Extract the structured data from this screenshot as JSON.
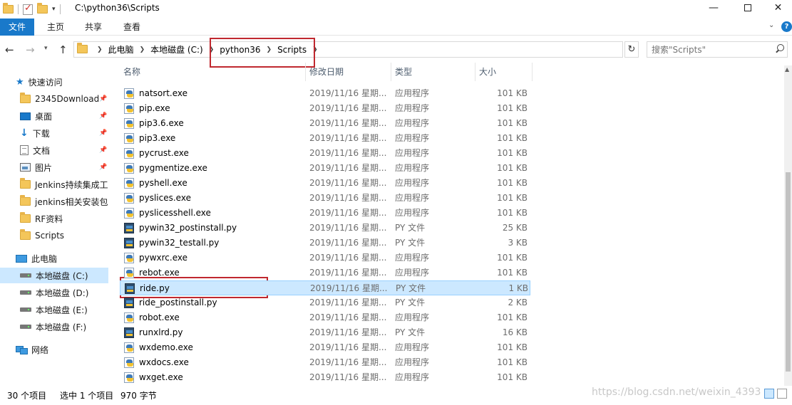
{
  "window": {
    "title": "C:\\python36\\Scripts",
    "minimize": "—",
    "close": "✕"
  },
  "ribbon": {
    "tabs": [
      {
        "label": "文件"
      },
      {
        "label": "主页"
      },
      {
        "label": "共享"
      },
      {
        "label": "查看"
      }
    ]
  },
  "address": {
    "crumbs": [
      "此电脑",
      "本地磁盘 (C:)",
      "python36",
      "Scripts"
    ],
    "search_placeholder": "搜索\"Scripts\""
  },
  "nav": {
    "items": [
      {
        "label": "快速访问",
        "icon": "star-icon",
        "pinned": false
      },
      {
        "label": "2345Download",
        "icon": "folder-icon",
        "pinned": true
      },
      {
        "label": "桌面",
        "icon": "desktop-icon",
        "pinned": true
      },
      {
        "label": "下载",
        "icon": "download-icon",
        "pinned": true
      },
      {
        "label": "文档",
        "icon": "document-icon",
        "pinned": true
      },
      {
        "label": "图片",
        "icon": "picture-icon",
        "pinned": true
      },
      {
        "label": "Jenkins持续集成工",
        "icon": "folder-icon",
        "pinned": false
      },
      {
        "label": "jenkins相关安装包",
        "icon": "folder-icon",
        "pinned": false
      },
      {
        "label": "RF资料",
        "icon": "folder-icon",
        "pinned": false
      },
      {
        "label": "Scripts",
        "icon": "folder-icon",
        "pinned": false
      },
      {
        "label": "此电脑",
        "icon": "computer-icon",
        "pinned": false
      },
      {
        "label": "本地磁盘 (C:)",
        "icon": "drive-icon",
        "pinned": false,
        "selected": true
      },
      {
        "label": "本地磁盘 (D:)",
        "icon": "drive-icon",
        "pinned": false
      },
      {
        "label": "本地磁盘 (E:)",
        "icon": "drive-icon",
        "pinned": false
      },
      {
        "label": "本地磁盘 (F:)",
        "icon": "drive-icon",
        "pinned": false
      },
      {
        "label": "网络",
        "icon": "network-icon",
        "pinned": false
      }
    ]
  },
  "columns": {
    "name": "名称",
    "date": "修改日期",
    "type": "类型",
    "size": "大小"
  },
  "files": [
    {
      "name": "natsort.exe",
      "date": "2019/11/16 星期...",
      "type": "应用程序",
      "size": "101 KB",
      "kind": "exe"
    },
    {
      "name": "pip.exe",
      "date": "2019/11/16 星期...",
      "type": "应用程序",
      "size": "101 KB",
      "kind": "exe"
    },
    {
      "name": "pip3.6.exe",
      "date": "2019/11/16 星期...",
      "type": "应用程序",
      "size": "101 KB",
      "kind": "exe"
    },
    {
      "name": "pip3.exe",
      "date": "2019/11/16 星期...",
      "type": "应用程序",
      "size": "101 KB",
      "kind": "exe"
    },
    {
      "name": "pycrust.exe",
      "date": "2019/11/16 星期...",
      "type": "应用程序",
      "size": "101 KB",
      "kind": "exe"
    },
    {
      "name": "pygmentize.exe",
      "date": "2019/11/16 星期...",
      "type": "应用程序",
      "size": "101 KB",
      "kind": "exe"
    },
    {
      "name": "pyshell.exe",
      "date": "2019/11/16 星期...",
      "type": "应用程序",
      "size": "101 KB",
      "kind": "exe"
    },
    {
      "name": "pyslices.exe",
      "date": "2019/11/16 星期...",
      "type": "应用程序",
      "size": "101 KB",
      "kind": "exe"
    },
    {
      "name": "pyslicesshell.exe",
      "date": "2019/11/16 星期...",
      "type": "应用程序",
      "size": "101 KB",
      "kind": "exe"
    },
    {
      "name": "pywin32_postinstall.py",
      "date": "2019/11/16 星期...",
      "type": "PY 文件",
      "size": "25 KB",
      "kind": "py"
    },
    {
      "name": "pywin32_testall.py",
      "date": "2019/11/16 星期...",
      "type": "PY 文件",
      "size": "3 KB",
      "kind": "py"
    },
    {
      "name": "pywxrc.exe",
      "date": "2019/11/16 星期...",
      "type": "应用程序",
      "size": "101 KB",
      "kind": "exe"
    },
    {
      "name": "rebot.exe",
      "date": "2019/11/16 星期...",
      "type": "应用程序",
      "size": "101 KB",
      "kind": "exe"
    },
    {
      "name": "ride.py",
      "date": "2019/11/16 星期...",
      "type": "PY 文件",
      "size": "1 KB",
      "kind": "py",
      "selected": true
    },
    {
      "name": "ride_postinstall.py",
      "date": "2019/11/16 星期...",
      "type": "PY 文件",
      "size": "2 KB",
      "kind": "py"
    },
    {
      "name": "robot.exe",
      "date": "2019/11/16 星期...",
      "type": "应用程序",
      "size": "101 KB",
      "kind": "exe"
    },
    {
      "name": "runxlrd.py",
      "date": "2019/11/16 星期...",
      "type": "PY 文件",
      "size": "16 KB",
      "kind": "py"
    },
    {
      "name": "wxdemo.exe",
      "date": "2019/11/16 星期...",
      "type": "应用程序",
      "size": "101 KB",
      "kind": "exe"
    },
    {
      "name": "wxdocs.exe",
      "date": "2019/11/16 星期...",
      "type": "应用程序",
      "size": "101 KB",
      "kind": "exe"
    },
    {
      "name": "wxget.exe",
      "date": "2019/11/16 星期...",
      "type": "应用程序",
      "size": "101 KB",
      "kind": "exe"
    }
  ],
  "status": {
    "count": "30 个项目",
    "selected": "选中 1 个项目",
    "size": "970 字节"
  },
  "watermark": "https://blog.csdn.net/weixin_4393"
}
